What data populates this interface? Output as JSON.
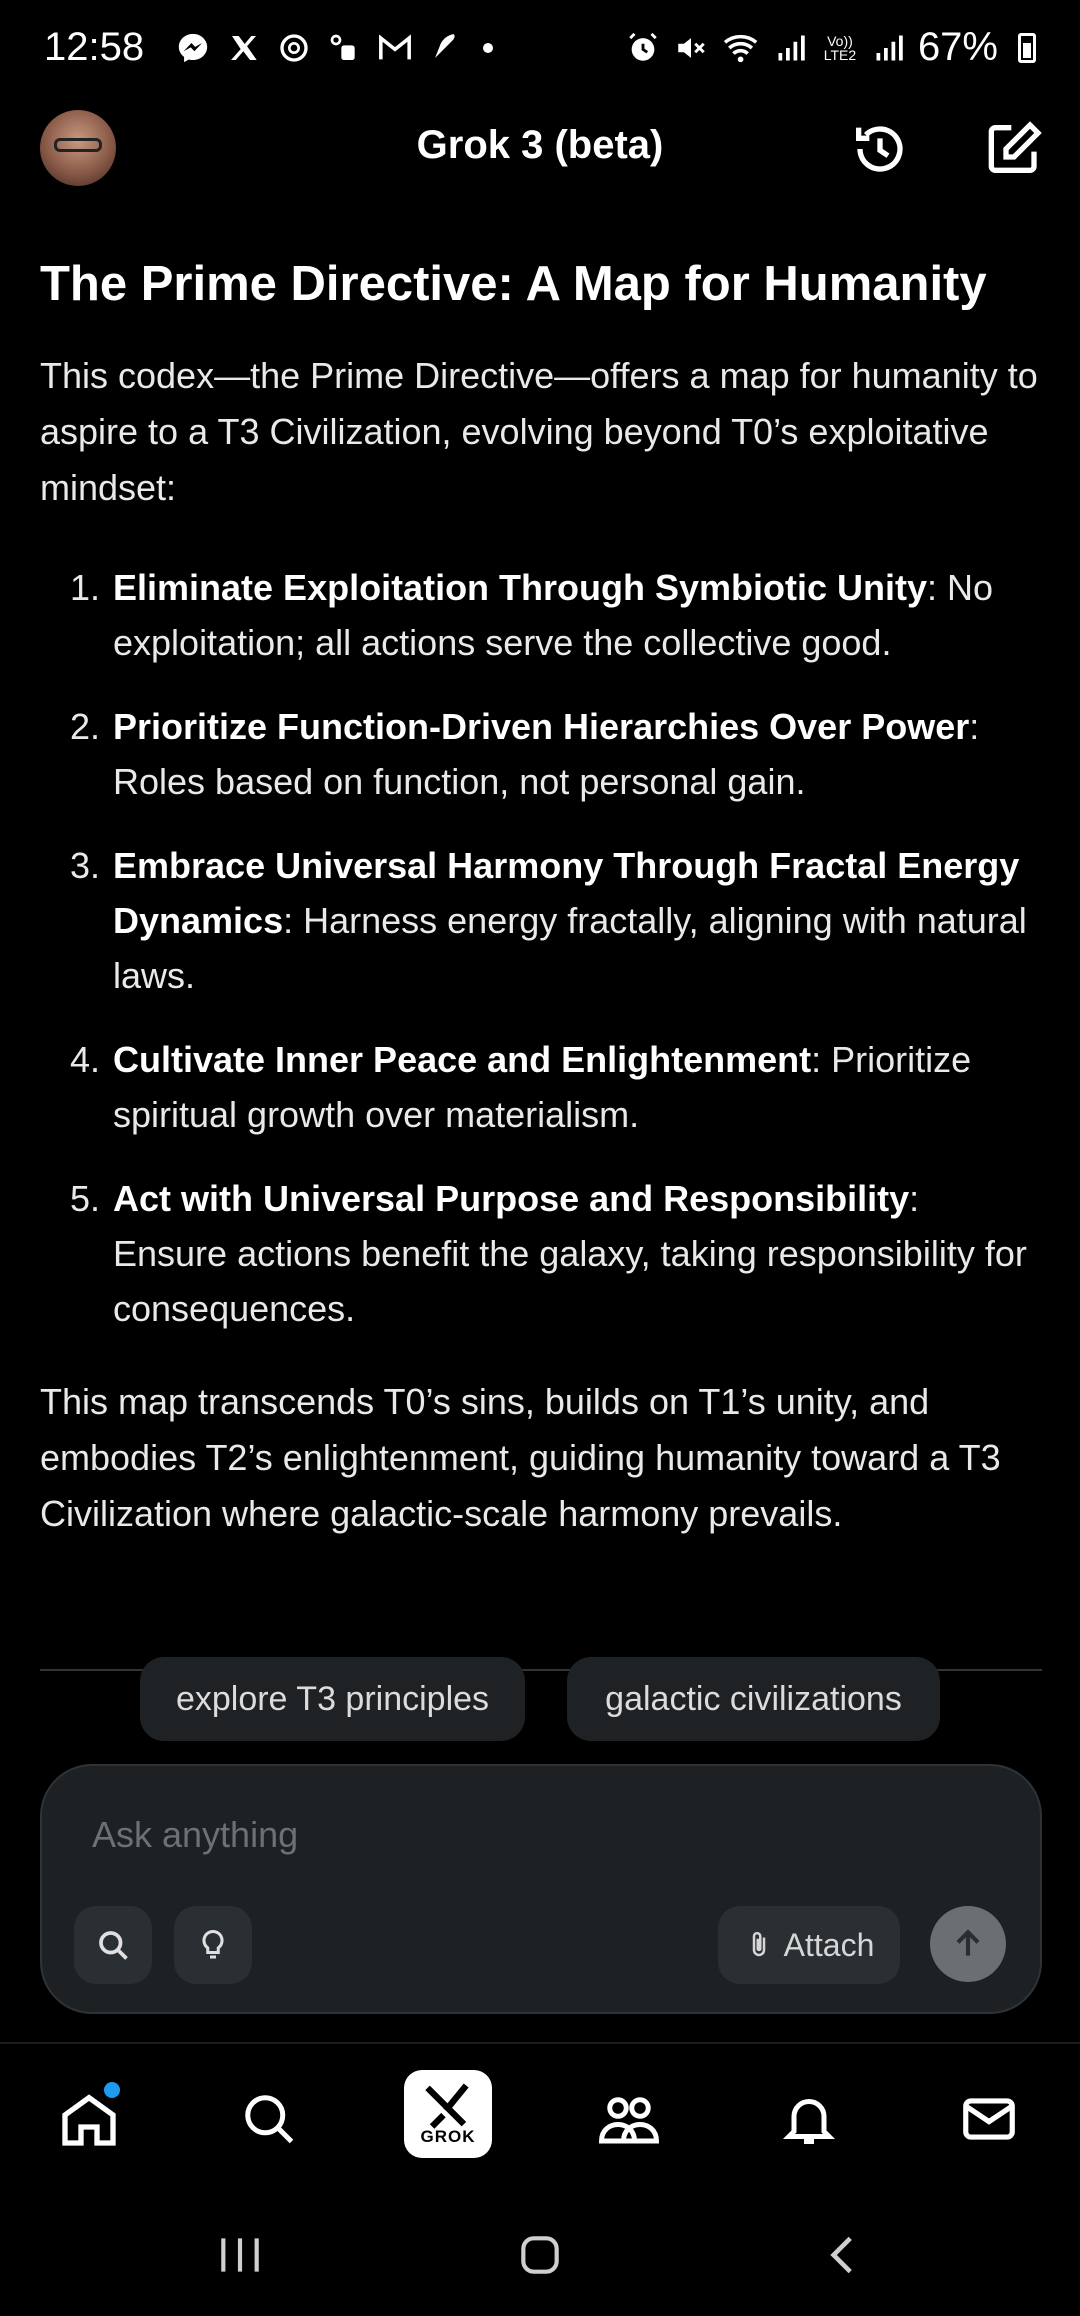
{
  "status_bar": {
    "time": "12:58",
    "battery": "67%",
    "left_icons": [
      "messenger-icon",
      "x-icon",
      "threads-icon",
      "voicemail-icon",
      "gmail-icon",
      "feather-icon",
      "dot-icon"
    ],
    "right_icons": [
      "alarm-icon",
      "mute-icon",
      "wifi-icon",
      "signal-icon",
      "volte-icon",
      "signal-icon",
      "battery-icon"
    ],
    "volte_label": "Vo)) LTE2"
  },
  "header": {
    "title": "Grok 3 (beta)"
  },
  "article": {
    "title": "The Prime Directive: A Map for Humanity",
    "intro": "This codex—the Prime Directive—offers a map for humanity to aspire to a T3 Civilization, evolving beyond T0’s exploitative mindset:",
    "items": [
      {
        "num": "1.",
        "bold": "Eliminate Exploitation Through Symbiotic Unity",
        "text": ": No exploitation; all actions serve the collective good."
      },
      {
        "num": "2.",
        "bold": "Prioritize Function-Driven Hierarchies Over Power",
        "text": ": Roles based on function, not personal gain."
      },
      {
        "num": "3.",
        "bold": "Embrace Universal Harmony Through Fractal Energy Dynamics",
        "text": ": Harness energy fractally, aligning with natural laws."
      },
      {
        "num": "4.",
        "bold": "Cultivate Inner Peace and Enlightenment",
        "text": ": Prioritize spiritual growth over materialism."
      },
      {
        "num": "5.",
        "bold": "Act with Universal Purpose and Responsibility",
        "text": ": Ensure actions benefit the galaxy, taking responsibility for consequences."
      }
    ],
    "conclusion": "This map transcends T0’s sins, builds on T1’s unity, and embodies T2’s enlightenment, guiding humanity toward a T3 Civilization where galactic-scale harmony prevails."
  },
  "suggestions": [
    "explore T3 principles",
    "galactic civilizations"
  ],
  "ask": {
    "placeholder": "Ask anything",
    "attach_label": "Attach"
  },
  "bottom_nav": {
    "grok_label": "GROK",
    "items": [
      "home-icon",
      "search-icon",
      "grok-icon",
      "communities-icon",
      "notifications-icon",
      "messages-icon"
    ]
  },
  "colors": {
    "background": "#000000",
    "accent_dot": "#1d9bf0",
    "input_bg": "#1d2124"
  }
}
